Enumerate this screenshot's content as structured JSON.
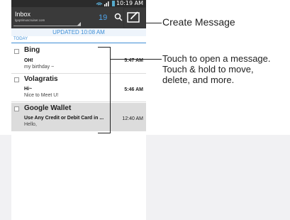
{
  "statusbar": {
    "time": "10:19 AM"
  },
  "header": {
    "inbox_label": "Inbox",
    "account": "lgoptimuscruiser.com",
    "unread_count": "19"
  },
  "banner": {
    "updated": "UPDATED 10:08 AM"
  },
  "section": {
    "today": "TODAY"
  },
  "messages": [
    {
      "sender": "Bing",
      "subject": "OH!",
      "preview": "my birthday ~",
      "time": "5:47 AM"
    },
    {
      "sender": "Volagratis",
      "subject": "Hi~",
      "preview": "Nice to Meet U!",
      "time": "5:46 AM"
    },
    {
      "sender": "Google Wallet",
      "subject": "Use Any Credit or Debit Card in ...",
      "preview": "Hello,",
      "time": "12:40 AM"
    }
  ],
  "callouts": {
    "create": "Create Message",
    "touch_line1": "Touch to open a message.",
    "touch_line2": "Touch & hold to move,",
    "touch_line3": "delete, and more."
  },
  "colors": {
    "accent": "#3f8fd6",
    "appbar": "#3a3a3a",
    "highlight_row": "#dcdcdc"
  },
  "icons": [
    "search-icon",
    "compose-icon",
    "wifi-icon",
    "signal-icon",
    "battery-icon"
  ]
}
